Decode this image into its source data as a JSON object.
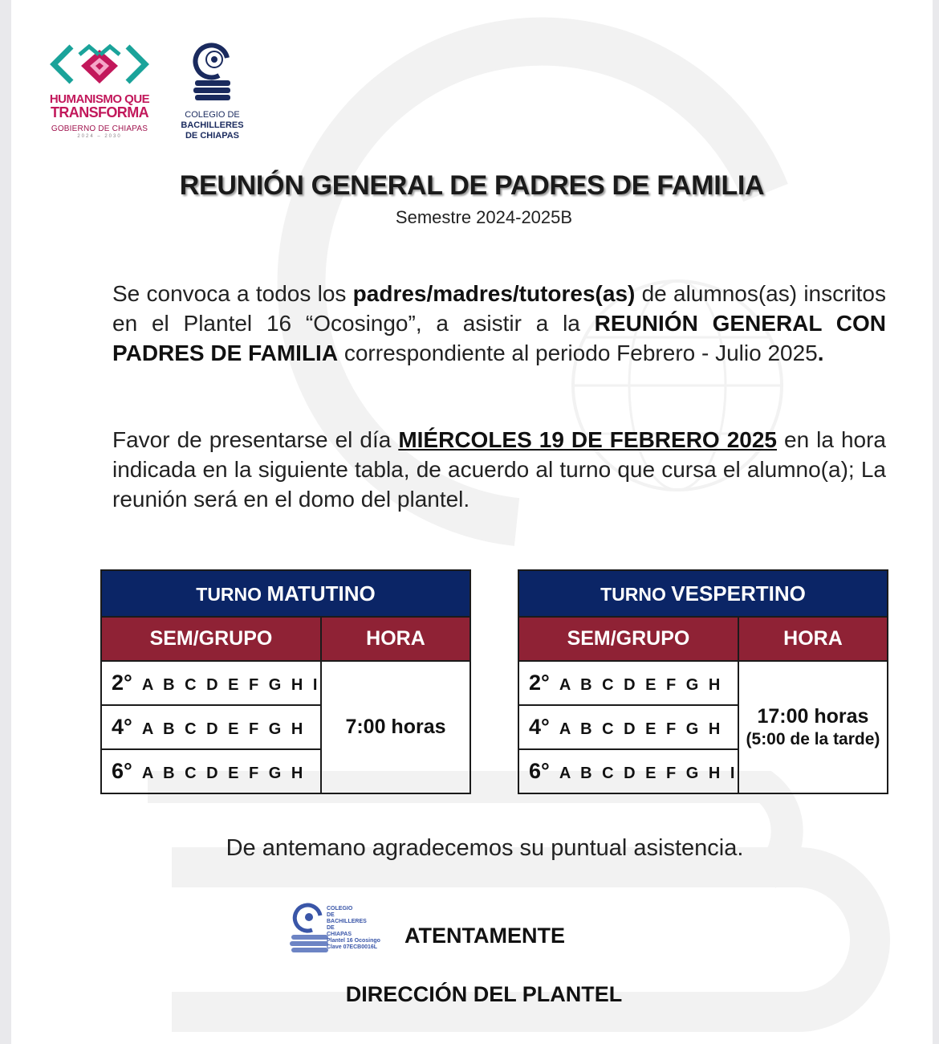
{
  "header": {
    "gov_logo": {
      "line1": "HUMANISMO QUE",
      "line2": "TRANSFORMA",
      "gov": "GOBIERNO DE CHIAPAS",
      "years": "2024 – 2030"
    },
    "cobach_logo": {
      "line1": "COLEGIO DE",
      "line2": "BACHILLERES",
      "line3": "DE CHIAPAS"
    }
  },
  "title": "REUNIÓN GENERAL DE PADRES DE FAMILIA",
  "subtitle": "Semestre 2024-2025B",
  "paragraph1": {
    "a": "Se convoca a todos los ",
    "b": "padres/madres/tutores(as)",
    "c": " de alumnos(as) inscritos en el Plantel 16 “Ocosingo”, a asistir a la ",
    "d": "REUNIÓN GENERAL CON PADRES DE FAMILIA",
    "e": " correspondiente al periodo Febrero - Julio 2025",
    "f": "."
  },
  "paragraph2": {
    "a": "Favor de presentarse el día ",
    "b": "MIÉRCOLES 19 DE FEBRERO 2025",
    "c": " en la hora indicada en la siguiente tabla, de acuerdo al turno que cursa el alumno(a); La reunión será en el domo del plantel."
  },
  "tables": {
    "matutino": {
      "title_a": "TURNO ",
      "title_b": "MATUTINO",
      "col1": "SEM/GRUPO",
      "col2": "HORA",
      "rows": [
        {
          "sem": "2°",
          "groups": "A B C D E F G H I"
        },
        {
          "sem": "4°",
          "groups": "A B C D E F G H"
        },
        {
          "sem": "6°",
          "groups": "A B C D E F G H"
        }
      ],
      "hora": "7:00 horas"
    },
    "vespertino": {
      "title_a": "TURNO ",
      "title_b": "VESPERTINO",
      "col1": "SEM/GRUPO",
      "col2": "HORA",
      "rows": [
        {
          "sem": "2°",
          "groups": "A B C D E F G H"
        },
        {
          "sem": "4°",
          "groups": "A B C D E F G H"
        },
        {
          "sem": "6°",
          "groups": "A B C D E F G H I"
        }
      ],
      "hora": "17:00 horas",
      "hora_note": "(5:00 de la tarde)"
    }
  },
  "thanks": "De antemano agradecemos su puntual asistencia.",
  "stamp": {
    "l1": "COLEGIO",
    "l2": "DE",
    "l3": "BACHILLERES",
    "l4": "DE",
    "l5": "CHIAPAS",
    "l6": "Plantel 16 Ocosingo",
    "l7": "Clave 07ECB0016L"
  },
  "closing": "ATENTAMENTE",
  "signature": "DIRECCIÓN DEL PLANTEL",
  "colors": {
    "navy": "#0b2566",
    "maroon": "#8f2235",
    "logo_pink": "#c2185b",
    "logo_teal": "#1aa39a",
    "cobach_blue": "#1a2a5e"
  }
}
